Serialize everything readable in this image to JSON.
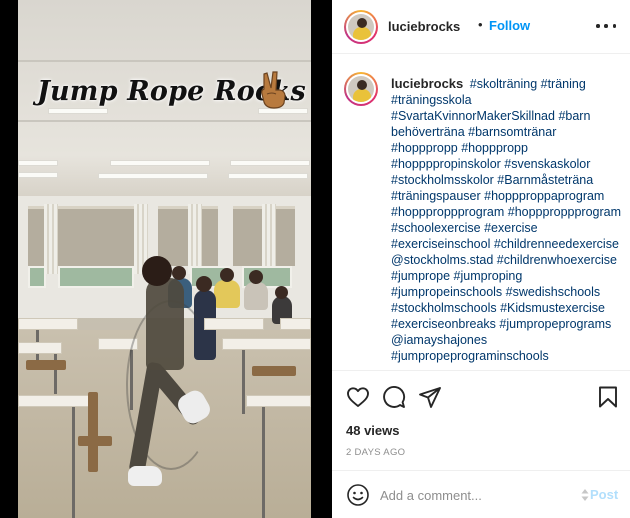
{
  "media": {
    "overlay_title": "Jump Rope Rocks",
    "emoji_icon": "victory-hand-icon"
  },
  "header": {
    "username": "luciebrocks",
    "separator": "•",
    "follow_label": "Follow",
    "more_icon": "more-options-icon"
  },
  "caption": {
    "username": "luciebrocks",
    "text": "#skolträning #träning #träningsskola #SvartaKvinnorMakerSkillnad #barn behöverträna #barnsomtränar #hopppropp #hopppropp #hoppppropinskolor #svenskaskolor #stockholmsskolor #Barnmåsteträna #träningspauser #hoppproppaprogram #hoppproppprogram #hoppproppprogram #schoolexercise #exercise #exerciseinschool #childrenneedexercise @stockholms.stad #childrenwhoexercise #jumprope #jumproping #jumpropeinschools #swedishschools #stockholmschools #Kidsmustexercise #exerciseonbreaks #jumpropeprograms @iamayshajones #jumpropeprograminschools"
  },
  "actions": {
    "views": "48 views",
    "time_ago": "2 days ago"
  },
  "comment": {
    "placeholder": "Add a comment...",
    "post_label": "Post"
  },
  "colors": {
    "link": "#00376b",
    "follow": "#0095f6",
    "post_disabled": "#b2dffc",
    "muted": "#8e8e8e",
    "border": "#efefef"
  }
}
